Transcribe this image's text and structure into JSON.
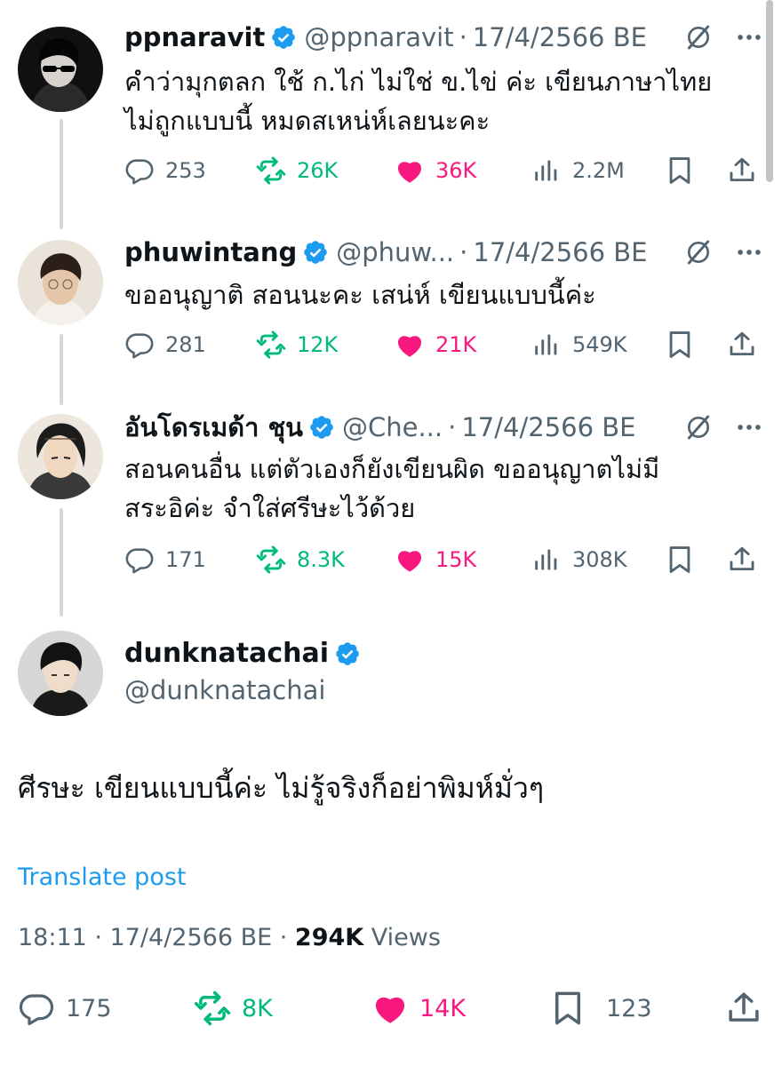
{
  "tweets": [
    {
      "name": "ppnaravit",
      "handle": "@ppnaravit",
      "date": "17/4/2566 BE",
      "lines": [
        "คำว่ามุกตลก ใช้ ก.ไก่ ไม่ใช่ ข.ไข่ ค่ะ เขียนภาษาไทย",
        "ไม่ถูกแบบนี้ หมดสเหน่ห์เลยนะคะ"
      ],
      "replies": "253",
      "reposts": "26K",
      "likes": "36K",
      "views": "2.2M",
      "avatar": "dark-sunglasses"
    },
    {
      "name": "phuwintang",
      "handle": "@phuw...",
      "date": "17/4/2566 BE",
      "lines": [
        "ขออนุญาติ สอนนะคะ เสน่ห์ เขียนแบบนี้ค่ะ"
      ],
      "replies": "281",
      "reposts": "12K",
      "likes": "21K",
      "views": "549K",
      "avatar": "light-portrait"
    },
    {
      "name": "อันโดรเมด้า ชุน",
      "handle": "@Che...",
      "date": "17/4/2566 BE",
      "lines": [
        "สอนคนอื่น แต่ตัวเองก็ยังเขียนผิด ขออนุญาตไม่มี",
        "สระอิค่ะ จำใส่ศรีษะไว้ด้วย"
      ],
      "replies": "171",
      "reposts": "8.3K",
      "likes": "15K",
      "views": "308K",
      "avatar": "anime-character"
    }
  ],
  "main": {
    "name": "dunknatachai",
    "handle": "@dunknatachai",
    "text": "ศีรษะ เขียนแบบนี้ค่ะ ไม่รู้จริงก็อย่าพิมห์มั่วๆ",
    "translate": "Translate post",
    "time": "18:11 · 17/4/2566 BE · ",
    "views_count": "294K",
    "views_label": " Views",
    "replies": "175",
    "reposts": "8K",
    "likes": "14K",
    "bookmarks": "123"
  },
  "colors": {
    "accent": "#1d9bf0",
    "repost": "#00ba7c",
    "like": "#f91880",
    "secondary_text": "#536471"
  },
  "icons": [
    "verified-badge-icon",
    "grok-icon",
    "more-icon",
    "reply-icon",
    "repost-icon",
    "like-icon",
    "views-icon",
    "bookmark-icon",
    "share-icon"
  ]
}
